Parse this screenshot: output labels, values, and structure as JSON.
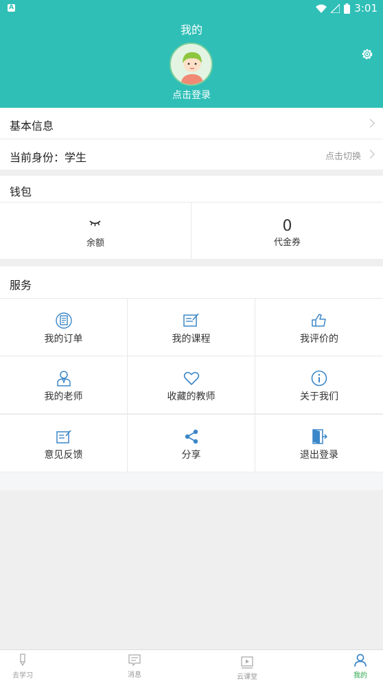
{
  "status_bar": {
    "time": "3:01",
    "app_icon": "A"
  },
  "header": {
    "title": "我的",
    "login_label": "点击登录"
  },
  "profile": {
    "basic_info": "基本信息",
    "identity": "当前身份：学生",
    "switch_hint": "点击切换"
  },
  "wallet": {
    "title": "钱包",
    "balance_label": "余额",
    "voucher_value": "0",
    "voucher_label": "代金券"
  },
  "services": {
    "title": "服务",
    "items": [
      {
        "label": "我的订单",
        "icon": "order-icon"
      },
      {
        "label": "我的课程",
        "icon": "course-icon"
      },
      {
        "label": "我评价的",
        "icon": "thumbs-up-icon"
      },
      {
        "label": "我的老师",
        "icon": "teacher-icon"
      },
      {
        "label": "收藏的教师",
        "icon": "heart-icon"
      },
      {
        "label": "关于我们",
        "icon": "info-icon"
      },
      {
        "label": "意见反馈",
        "icon": "feedback-icon"
      },
      {
        "label": "分享",
        "icon": "share-icon"
      },
      {
        "label": "退出登录",
        "icon": "logout-icon"
      }
    ]
  },
  "tabbar": {
    "tabs": [
      {
        "label": "去学习",
        "icon": "pen-icon"
      },
      {
        "label": "消息",
        "icon": "message-icon"
      },
      {
        "label": "云课堂",
        "icon": "video-icon"
      },
      {
        "label": "我的",
        "icon": "person-icon"
      }
    ],
    "active_index": 3
  },
  "colors": {
    "accent": "#2fbfb7",
    "icon_blue": "#3a86c8",
    "active_tab": "#2aa64a"
  }
}
